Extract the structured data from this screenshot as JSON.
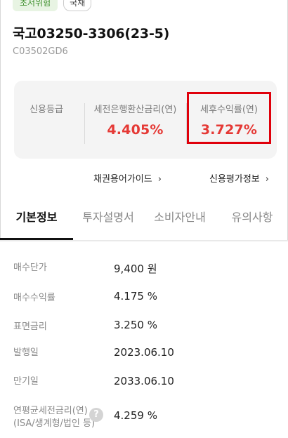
{
  "tags": {
    "risk": "초저위험",
    "type": "국채"
  },
  "bond": {
    "name": "국고03250-3306(23-5)",
    "code": "C03502GD6"
  },
  "summary": {
    "credit_label": "신용등급",
    "pretax_label": "세전은행환산금리(연)",
    "pretax_value": "4.405%",
    "aftertax_label": "세후수익률(연)",
    "aftertax_value": "3.727%",
    "value_color": "#e53935",
    "highlight_color": "#e0000b"
  },
  "links": {
    "glossary": "채권용어가이드",
    "rating_info": "신용평가정보"
  },
  "tabs": [
    {
      "label": "기본정보",
      "active": true
    },
    {
      "label": "투자설명서",
      "active": false
    },
    {
      "label": "소비자안내",
      "active": false
    },
    {
      "label": "유의사항",
      "active": false
    }
  ],
  "info": {
    "rows": [
      {
        "label": "매수단가",
        "value": "9,400 원"
      },
      {
        "label": "매수수익률",
        "value": "4.175 %"
      },
      {
        "label": "표면금리",
        "value": "3.250 %"
      },
      {
        "label": "발행일",
        "value": "2023.06.10"
      },
      {
        "label": "만기일",
        "value": "2033.06.10"
      },
      {
        "label": "연평균세전금리(연)",
        "sublabel": "(ISA/생계형/법인 등)",
        "value": "4.259 %"
      }
    ]
  },
  "icons": {
    "help": "question-circle-icon",
    "chevron": "chevron-right-icon"
  }
}
